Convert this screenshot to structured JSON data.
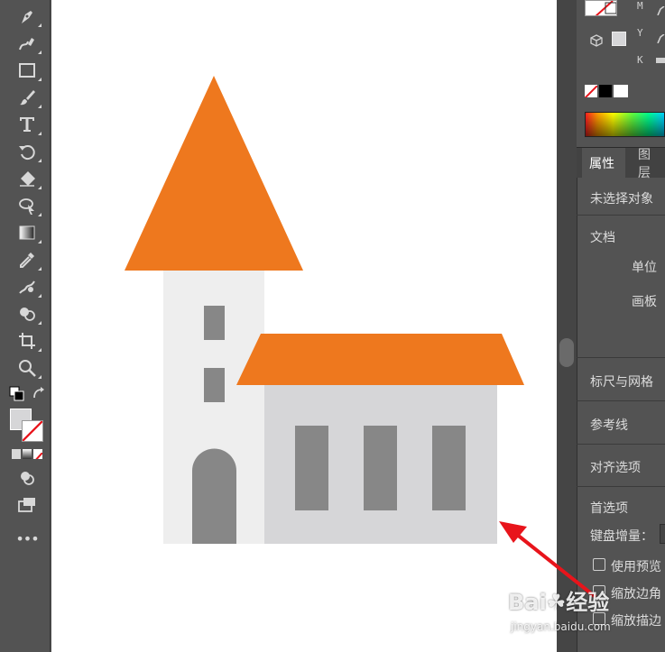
{
  "toolbar": {
    "more_label": "•••"
  },
  "color_panel": {
    "labels": [
      "M",
      "Y",
      "K"
    ]
  },
  "tabs": [
    {
      "label": "属性"
    },
    {
      "label": "图层"
    }
  ],
  "properties": {
    "no_selection": "未选择对象",
    "document_section": "文档",
    "unit_label": "单位",
    "artboard_label": "画板",
    "rulers_grid": "标尺与网格",
    "guides": "参考线",
    "snap_options": "对齐选项",
    "preferences": "首选项",
    "keyboard_increment": "键盘增量：",
    "use_preview_bounds": "使用预览",
    "scale_corners": "缩放边角",
    "scale_strokes": "缩放描边"
  },
  "colors": {
    "roof": "#ee781e",
    "tower_wall": "#eeeeee",
    "house_wall": "#d6d6d8",
    "window": "#878787",
    "annotation_arrow": "#e8141b"
  },
  "watermark": {
    "brand": "Bai☘经验",
    "url": "jingyan.baidu.com"
  }
}
